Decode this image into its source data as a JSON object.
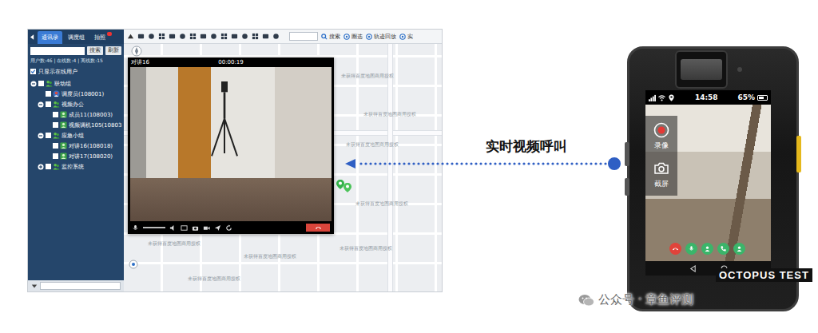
{
  "console": {
    "tabs": [
      {
        "label": "通讯录",
        "selected": true,
        "badge": false
      },
      {
        "label": "调度组",
        "selected": false,
        "badge": false
      },
      {
        "label": "拍照",
        "selected": false,
        "badge": true
      }
    ],
    "toolbar": {
      "search_button": "搜索",
      "actions": [
        "圈选",
        "轨迹回放",
        "实"
      ]
    },
    "sidebar": {
      "search_buttons": [
        "搜索",
        "刷新"
      ],
      "stats": "用户数:46 | 在线数:4 | 离线数:15",
      "online_only": {
        "label": "只显示在线用户",
        "checked": true
      },
      "tree": [
        {
          "label": "联动组",
          "kind": "group",
          "depth": 0,
          "expanded": true,
          "checked": false
        },
        {
          "label": "调度员(108001)",
          "kind": "dispatcher",
          "depth": 1,
          "expanded": false,
          "checked": false
        },
        {
          "label": "视频办公",
          "kind": "group",
          "depth": 1,
          "expanded": true,
          "checked": false
        },
        {
          "label": "成员11(108003)",
          "kind": "member",
          "depth": 2,
          "expanded": false,
          "checked": false
        },
        {
          "label": "视频调机105(10803",
          "kind": "member",
          "depth": 2,
          "expanded": false,
          "checked": false
        },
        {
          "label": "应急小组",
          "kind": "group",
          "depth": 1,
          "expanded": true,
          "checked": false
        },
        {
          "label": "对讲16(108018)",
          "kind": "member",
          "depth": 2,
          "expanded": false,
          "checked": false
        },
        {
          "label": "对讲17(108020)",
          "kind": "member",
          "depth": 2,
          "expanded": false,
          "checked": false
        },
        {
          "label": "监控系统",
          "kind": "group",
          "depth": 1,
          "expanded": false,
          "checked": false
        }
      ]
    },
    "map": {
      "labels": [
        "未获得百度地图商用授权",
        "未获得百度地图商用授权",
        "未获得百度地图商用授权",
        "未获得百度地图商用授权",
        "未获得百度地图商用授权",
        "未获得百度地图商用授权",
        "未获得百度地图商用授权",
        "未获得百度地图商用授权"
      ]
    },
    "video_window": {
      "title": "对讲16",
      "timer": "00:00:19"
    }
  },
  "caption": "实时视频呼叫",
  "device": {
    "time": "14:58",
    "battery": "65%",
    "battery_level": 0.65,
    "actions": [
      {
        "label": "录像"
      },
      {
        "label": "截屏"
      }
    ],
    "call_buttons": [
      {
        "color": "#e0433a"
      },
      {
        "color": "#3bb56a"
      },
      {
        "color": "#3bb56a"
      },
      {
        "color": "#3bb56a"
      },
      {
        "color": "#3bb56a"
      }
    ]
  },
  "watermark": {
    "brand": "OCTOPUS TEST",
    "account": "公众号 · 章鱼评测"
  }
}
